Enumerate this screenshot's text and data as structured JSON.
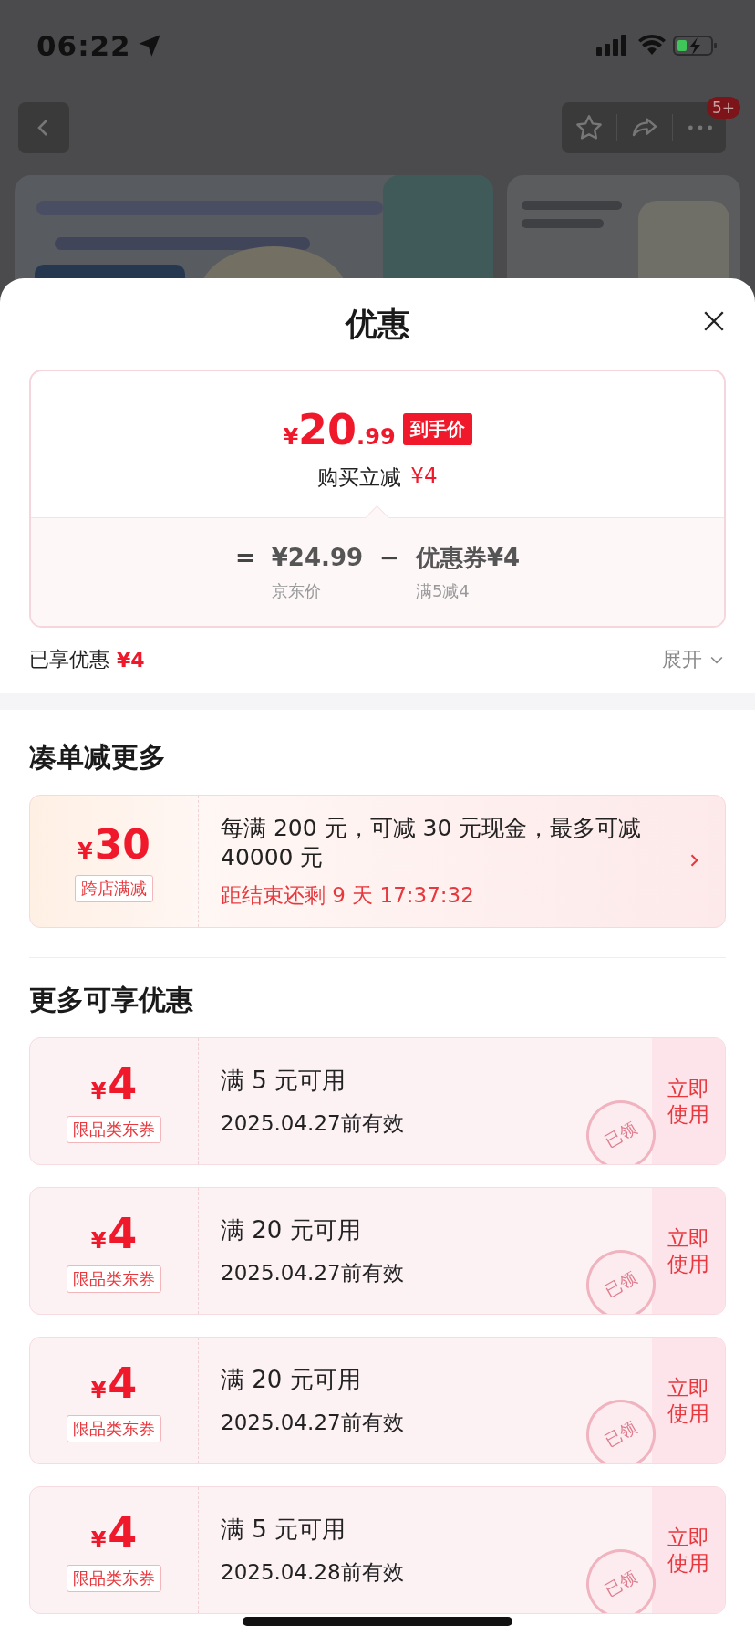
{
  "status_bar": {
    "time": "06:22"
  },
  "nav": {
    "badge": "5+"
  },
  "sheet": {
    "title": "优惠",
    "price": {
      "currency": "¥",
      "integer": "20",
      "decimal": ".99",
      "tag": "到手价",
      "subtitle": "购买立减",
      "subtitle_amount": "¥4"
    },
    "formula": {
      "equals": "=",
      "base": "¥24.99",
      "base_label": "京东价",
      "minus": "−",
      "coupon": "优惠券¥4",
      "coupon_label": "满5减4"
    },
    "enjoyed": {
      "label": "已享优惠",
      "amount": "¥4",
      "expand": "展开"
    }
  },
  "bundle": {
    "heading": "凑单减更多",
    "currency": "¥",
    "amount": "30",
    "tag": "跨店满减",
    "description": "每满 200 元，可减 30 元现金，最多可减 40000 元",
    "countdown": "距结束还剩 9 天 17:37:32"
  },
  "more": {
    "heading": "更多可享优惠",
    "coupons": [
      {
        "currency": "¥",
        "amount": "4",
        "tag": "限品类东券",
        "condition": "满 5 元可用",
        "validity": "2025.04.27前有效",
        "action": "立即使用",
        "stamp": "已领"
      },
      {
        "currency": "¥",
        "amount": "4",
        "tag": "限品类东券",
        "condition": "满 20 元可用",
        "validity": "2025.04.27前有效",
        "action": "立即使用",
        "stamp": "已领"
      },
      {
        "currency": "¥",
        "amount": "4",
        "tag": "限品类东券",
        "condition": "满 20 元可用",
        "validity": "2025.04.27前有效",
        "action": "立即使用",
        "stamp": "已领"
      },
      {
        "currency": "¥",
        "amount": "4",
        "tag": "限品类东券",
        "condition": "满 5 元可用",
        "validity": "2025.04.28前有效",
        "action": "立即使用",
        "stamp": "已领"
      }
    ]
  }
}
